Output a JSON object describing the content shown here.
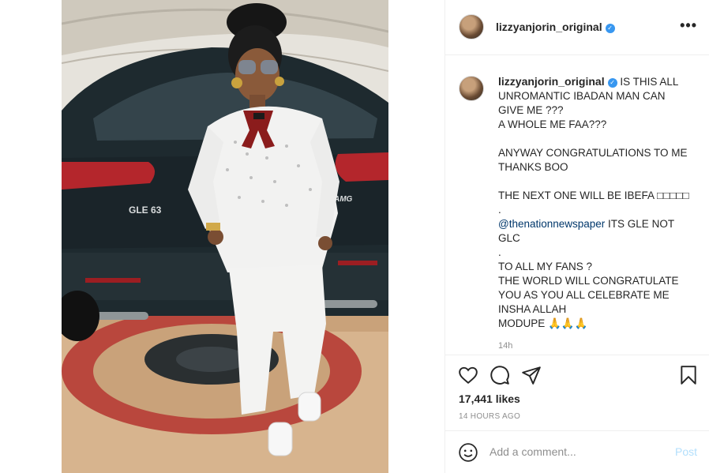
{
  "post": {
    "username": "lizzyanjorin_original",
    "verified_mark": "✓",
    "more_label": "•••"
  },
  "caption": {
    "username": "lizzyanjorin_original",
    "line1": "IS THIS ALL UNROMANTIC IBADAN MAN CAN GIVE ME ???",
    "line2": "A WHOLE ME FAA???",
    "line3": "ANYWAY CONGRATULATIONS TO ME THANKS BOO",
    "line4": "THE NEXT ONE WILL BE IBEFA □□□□□",
    "dot1": ".",
    "mention": "@thenationnewspaper",
    "mention_rest": " ITS GLE NOT GLC",
    "dot2": ".",
    "line5": "TO ALL MY FANS ?",
    "line6": "THE WORLD WILL CONGRATULATE YOU AS YOU ALL CELEBRATE ME INSHA ALLAH",
    "line7": "MODUPE 🙏🙏🙏",
    "time": "14h"
  },
  "stats": {
    "likes": "17,441 likes",
    "posted_ago": "14 HOURS AGO"
  },
  "comment": {
    "placeholder": "Add a comment...",
    "post_label": "Post"
  },
  "icons": {
    "like": "heart-icon",
    "comment": "comment-icon",
    "share": "share-icon",
    "save": "bookmark-icon",
    "emoji": "emoji-icon",
    "more": "more-options-icon"
  },
  "colors": {
    "accent": "#3897f0",
    "mention": "#00376b",
    "post_disabled": "#b2dffc",
    "muted": "#8e8e8e"
  },
  "photo_text": {
    "plate": "GLE 63",
    "badge": "AMG"
  }
}
